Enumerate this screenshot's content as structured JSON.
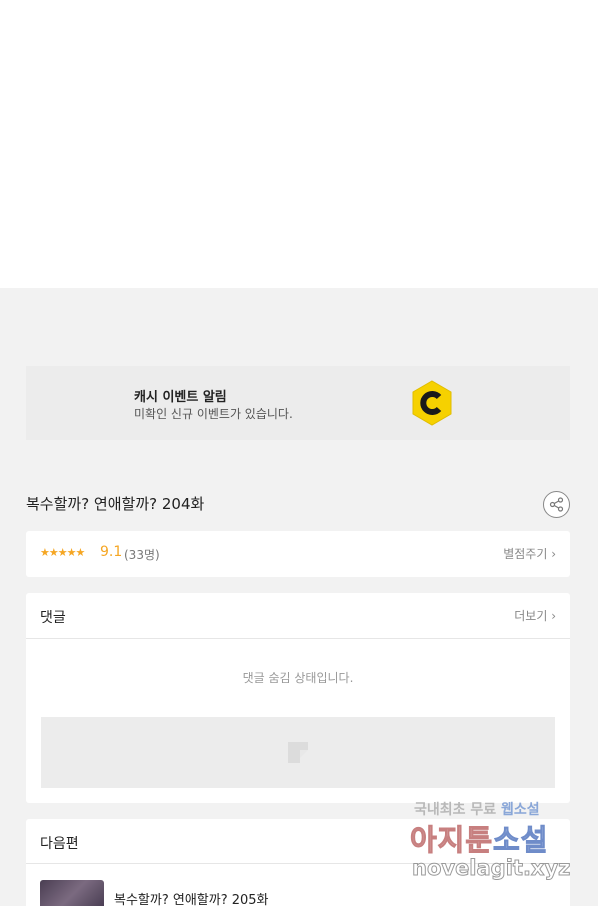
{
  "event_banner": {
    "title": "캐시 이벤트 알림",
    "description": "미확인 신규 이벤트가 있습니다.",
    "icon": "coin-c-icon",
    "icon_color": "#f6d100"
  },
  "episode": {
    "title": "복수할까? 연애할까? 204화"
  },
  "rating": {
    "stars": "★★★★★",
    "score": "9.1",
    "count": "(33명)",
    "rate_label": "별점주기 ›"
  },
  "comments": {
    "title": "댓글",
    "more_label": "더보기 ›",
    "hidden_message": "댓글 숨김 상태입니다."
  },
  "next_episode": {
    "header": "다음편",
    "item_title": "복수할까? 연애할까? 205화"
  },
  "watermark": {
    "line1_gray": "국내최초 무료",
    "line1_blue": "웹소설",
    "line2_red": "아지툰",
    "line2_blue": "소설",
    "line3": "novelagit.xyz"
  },
  "colors": {
    "accent_star": "#f5a623",
    "background_gray": "#f2f2f2"
  }
}
